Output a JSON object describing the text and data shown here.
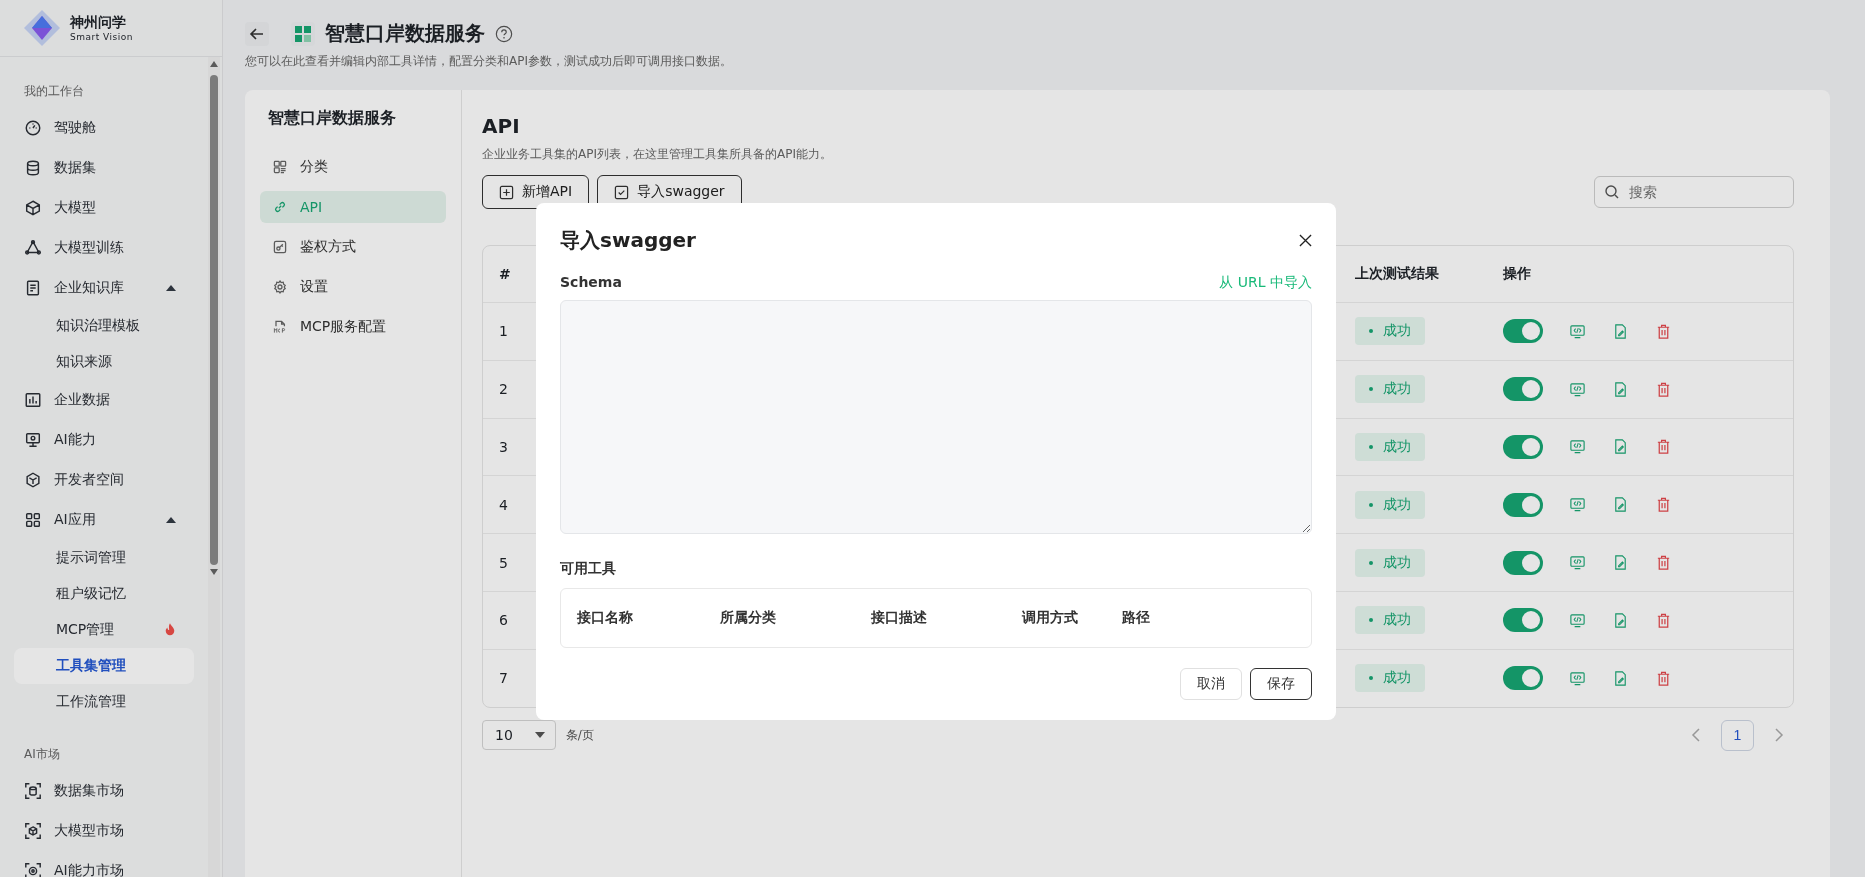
{
  "sidebar": {
    "brand": {
      "name": "神州问学",
      "tagline": "Smart Vision"
    },
    "sections": [
      {
        "title": "我的工作台",
        "items": [
          {
            "label": "驾驶舱",
            "selected": false
          },
          {
            "label": "数据集",
            "selected": false
          },
          {
            "label": "大模型",
            "selected": false
          },
          {
            "label": "大模型训练",
            "selected": false
          },
          {
            "label": "企业知识库",
            "selected": false,
            "expanded": true,
            "children": [
              {
                "label": "知识治理模板",
                "selected": false,
                "hot": false
              },
              {
                "label": "知识来源",
                "selected": false,
                "hot": false
              }
            ]
          },
          {
            "label": "企业数据",
            "selected": false
          },
          {
            "label": "AI能力",
            "selected": false
          },
          {
            "label": "开发者空间",
            "selected": false
          },
          {
            "label": "AI应用",
            "selected": false,
            "expanded": true,
            "children": [
              {
                "label": "提示词管理",
                "selected": false,
                "hot": false
              },
              {
                "label": "租户级记忆",
                "selected": false,
                "hot": false
              },
              {
                "label": "MCP管理",
                "selected": false,
                "hot": true
              },
              {
                "label": "工具集管理",
                "selected": true,
                "hot": false
              },
              {
                "label": "工作流管理",
                "selected": false,
                "hot": false
              }
            ]
          }
        ]
      },
      {
        "title": "AI市场",
        "items": [
          {
            "label": "数据集市场",
            "selected": false
          },
          {
            "label": "大模型市场",
            "selected": false
          },
          {
            "label": "AI能力市场",
            "selected": false
          }
        ]
      }
    ]
  },
  "header": {
    "title": "智慧口岸数据服务",
    "description": "您可以在此查看并编辑内部工具详情，配置分类和API参数，测试成功后即可调用接口数据。"
  },
  "nav": {
    "title": "智慧口岸数据服务",
    "items": [
      {
        "label": "分类",
        "selected": false
      },
      {
        "label": "API",
        "selected": true
      },
      {
        "label": "鉴权方式",
        "selected": false
      },
      {
        "label": "设置",
        "selected": false
      },
      {
        "label": "MCP服务配置",
        "selected": false
      }
    ]
  },
  "api": {
    "title": "API",
    "description": "企业业务工具集的API列表，在这里管理工具集所具备的API能力。",
    "buttons": [
      "新增API",
      "导入swagger"
    ],
    "search": {
      "placeholder": "搜索"
    }
  },
  "table": {
    "columns": [
      "#",
      "上次测试结果",
      "操作"
    ],
    "rows": [
      {
        "index": "1",
        "status": "成功",
        "enabled": true
      },
      {
        "index": "2",
        "status": "成功",
        "enabled": true
      },
      {
        "index": "3",
        "status": "成功",
        "enabled": true
      },
      {
        "index": "4",
        "status": "成功",
        "enabled": true
      },
      {
        "index": "5",
        "status": "成功",
        "enabled": true
      },
      {
        "index": "6",
        "status": "成功",
        "enabled": true
      },
      {
        "index": "7",
        "status": "成功",
        "enabled": true
      }
    ]
  },
  "pagination": {
    "page_size": "10",
    "unit": "条/页",
    "pages": [
      {
        "label": "1",
        "selected": true
      }
    ]
  },
  "dialog": {
    "title": "导入swagger",
    "schema_label": "Schema",
    "url_link": "从 URL 中导入",
    "tools_label": "可用工具",
    "tool_columns": [
      "接口名称",
      "所属分类",
      "接口描述",
      "调用方式",
      "路径"
    ],
    "buttons": [
      {
        "label": "取消",
        "kind": "secondary"
      },
      {
        "label": "保存",
        "kind": "primary"
      }
    ]
  }
}
